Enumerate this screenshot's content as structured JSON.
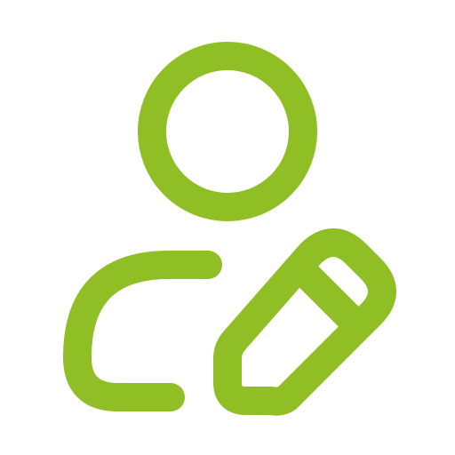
{
  "icon": {
    "name": "user-edit-icon",
    "stroke_color": "#8fbf24",
    "background": "#ffffff"
  }
}
